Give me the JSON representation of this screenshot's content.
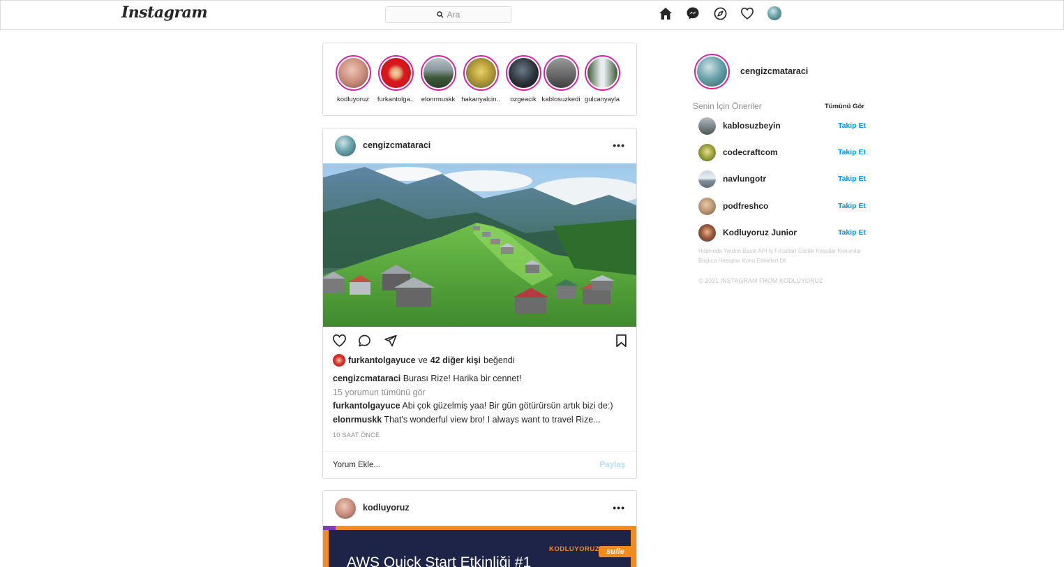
{
  "nav": {
    "logo": "Instagram",
    "search_placeholder": "Ara",
    "icons": [
      "home-icon",
      "messenger-icon",
      "explore-icon",
      "heart-icon",
      "profile-avatar"
    ]
  },
  "stories": [
    {
      "name": "kodluyoruz"
    },
    {
      "name": "furkantolga.."
    },
    {
      "name": "elonrmuskk"
    },
    {
      "name": "hakanyalcin.."
    },
    {
      "name": "ozgeacik"
    },
    {
      "name": "kablosuzkedi"
    },
    {
      "name": "gulcanyayla"
    }
  ],
  "post1": {
    "username": "cengizcmataraci",
    "more": "•••",
    "likes": {
      "user": "furkantolgayuce",
      "connector": "ve",
      "others": "42 diğer kişi",
      "suffix": "beğendi"
    },
    "caption": {
      "user": "cengizcmataraci",
      "text": "Burası Rize! Harika bir cennet!"
    },
    "view_comments": "15 yorumun tümünü gör",
    "comments": [
      {
        "user": "furkantolgayuce",
        "text": "Abi çok güzelmiş yaa! Bir gün götürürsün artık bizi de:)"
      },
      {
        "user": "elonrmuskk",
        "text": "That's wonderful view bro! I always want to travel Rize..."
      }
    ],
    "time": "10 SAAT ÖNCE",
    "add_comment_placeholder": "Yorum Ekle...",
    "share_label": "Paylaş"
  },
  "post2": {
    "username": "kodluyoruz",
    "more": "•••",
    "banner_brand": "KODLUYORUZ",
    "banner_partner": "sufle",
    "banner_title": "AWS Quick Start Etkinliği #1"
  },
  "sidebar": {
    "username": "cengizcmataraci",
    "suggestions_title": "Senin İçin Öneriler",
    "see_all": "Tümünü Gör",
    "follow_label": "Takip Et",
    "suggestions": [
      {
        "name": "kablosuzbeyin"
      },
      {
        "name": "codecraftcom"
      },
      {
        "name": "navlungotr"
      },
      {
        "name": "podfreshco"
      },
      {
        "name": "Kodluyoruz Junior"
      }
    ],
    "footer_links": "Hakkında Yardım Basın API İş Fırsatları Gizlilik Koşullar Konumlar Başlıca Hesaplar Konu Etiketleri Dil",
    "copyright": "© 2021 INSTAGRAM FROM KODLUYORUZ"
  },
  "colors": {
    "story_ring": "#d6249f",
    "follow_blue": "#0095f6",
    "share_disabled": "#b2dffc",
    "border": "#dbdbdb"
  }
}
